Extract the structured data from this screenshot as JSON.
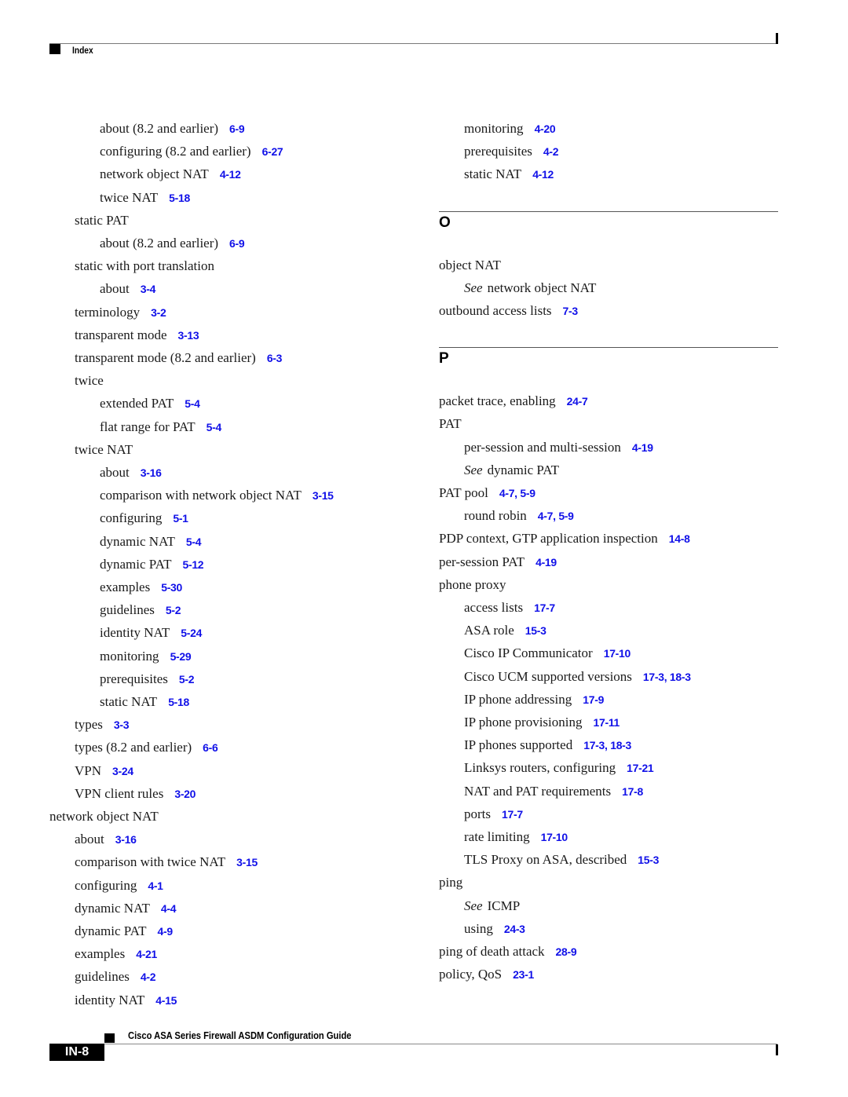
{
  "header": {
    "section_label": "Index"
  },
  "footer": {
    "book_title": "Cisco ASA Series Firewall ASDM Configuration Guide",
    "page_number": "IN-8"
  },
  "colors": {
    "link": "#1010e8",
    "text": "#1a1a1a",
    "rule": "#7a7a7a"
  },
  "left_column": [
    {
      "level": 2,
      "text": "about (8.2 and earlier)",
      "refs": [
        "6-9"
      ]
    },
    {
      "level": 2,
      "text": "configuring (8.2 and earlier)",
      "refs": [
        "6-27"
      ]
    },
    {
      "level": 2,
      "text": "network object NAT",
      "refs": [
        "4-12"
      ]
    },
    {
      "level": 2,
      "text": "twice NAT",
      "refs": [
        "5-18"
      ]
    },
    {
      "level": 1,
      "text": "static PAT",
      "refs": []
    },
    {
      "level": 2,
      "text": "about (8.2 and earlier)",
      "refs": [
        "6-9"
      ]
    },
    {
      "level": 1,
      "text": "static with port translation",
      "refs": []
    },
    {
      "level": 2,
      "text": "about",
      "refs": [
        "3-4"
      ]
    },
    {
      "level": 1,
      "text": "terminology",
      "refs": [
        "3-2"
      ]
    },
    {
      "level": 1,
      "text": "transparent mode",
      "refs": [
        "3-13"
      ]
    },
    {
      "level": 1,
      "text": "transparent mode (8.2 and earlier)",
      "refs": [
        "6-3"
      ]
    },
    {
      "level": 1,
      "text": "twice",
      "refs": []
    },
    {
      "level": 2,
      "text": "extended PAT",
      "refs": [
        "5-4"
      ]
    },
    {
      "level": 2,
      "text": "flat range for PAT",
      "refs": [
        "5-4"
      ]
    },
    {
      "level": 1,
      "text": "twice NAT",
      "refs": []
    },
    {
      "level": 2,
      "text": "about",
      "refs": [
        "3-16"
      ]
    },
    {
      "level": 2,
      "text": "comparison with network object NAT",
      "refs": [
        "3-15"
      ]
    },
    {
      "level": 2,
      "text": "configuring",
      "refs": [
        "5-1"
      ]
    },
    {
      "level": 2,
      "text": "dynamic NAT",
      "refs": [
        "5-4"
      ]
    },
    {
      "level": 2,
      "text": "dynamic PAT",
      "refs": [
        "5-12"
      ]
    },
    {
      "level": 2,
      "text": "examples",
      "refs": [
        "5-30"
      ]
    },
    {
      "level": 2,
      "text": "guidelines",
      "refs": [
        "5-2"
      ]
    },
    {
      "level": 2,
      "text": "identity NAT",
      "refs": [
        "5-24"
      ]
    },
    {
      "level": 2,
      "text": "monitoring",
      "refs": [
        "5-29"
      ]
    },
    {
      "level": 2,
      "text": "prerequisites",
      "refs": [
        "5-2"
      ]
    },
    {
      "level": 2,
      "text": "static NAT",
      "refs": [
        "5-18"
      ]
    },
    {
      "level": 1,
      "text": "types",
      "refs": [
        "3-3"
      ]
    },
    {
      "level": 1,
      "text": "types (8.2 and earlier)",
      "refs": [
        "6-6"
      ]
    },
    {
      "level": 1,
      "text": "VPN",
      "refs": [
        "3-24"
      ]
    },
    {
      "level": 1,
      "text": "VPN client rules",
      "refs": [
        "3-20"
      ]
    },
    {
      "level": 0,
      "text": "network object NAT",
      "refs": []
    },
    {
      "level": 1,
      "text": "about",
      "refs": [
        "3-16"
      ]
    },
    {
      "level": 1,
      "text": "comparison with twice NAT",
      "refs": [
        "3-15"
      ]
    },
    {
      "level": 1,
      "text": "configuring",
      "refs": [
        "4-1"
      ]
    },
    {
      "level": 1,
      "text": "dynamic NAT",
      "refs": [
        "4-4"
      ]
    },
    {
      "level": 1,
      "text": "dynamic PAT",
      "refs": [
        "4-9"
      ]
    },
    {
      "level": 1,
      "text": "examples",
      "refs": [
        "4-21"
      ]
    },
    {
      "level": 1,
      "text": "guidelines",
      "refs": [
        "4-2"
      ]
    },
    {
      "level": 1,
      "text": "identity NAT",
      "refs": [
        "4-15"
      ]
    }
  ],
  "right_column": [
    {
      "type": "entry",
      "level": 1,
      "text": "monitoring",
      "refs": [
        "4-20"
      ]
    },
    {
      "type": "entry",
      "level": 1,
      "text": "prerequisites",
      "refs": [
        "4-2"
      ]
    },
    {
      "type": "entry",
      "level": 1,
      "text": "static NAT",
      "refs": [
        "4-12"
      ]
    },
    {
      "type": "section",
      "letter": "O"
    },
    {
      "type": "entry",
      "level": 0,
      "text": "object NAT",
      "refs": []
    },
    {
      "type": "entry",
      "level": 1,
      "see": "See",
      "text": "network object NAT",
      "refs": []
    },
    {
      "type": "entry",
      "level": 0,
      "text": "outbound access lists",
      "refs": [
        "7-3"
      ]
    },
    {
      "type": "section",
      "letter": "P"
    },
    {
      "type": "entry",
      "level": 0,
      "text": "packet trace, enabling",
      "refs": [
        "24-7"
      ]
    },
    {
      "type": "entry",
      "level": 0,
      "text": "PAT",
      "refs": []
    },
    {
      "type": "entry",
      "level": 1,
      "text": "per-session and multi-session",
      "refs": [
        "4-19"
      ]
    },
    {
      "type": "entry",
      "level": 1,
      "see": "See",
      "text": "dynamic PAT",
      "refs": []
    },
    {
      "type": "entry",
      "level": 0,
      "text": "PAT pool",
      "refs": [
        "4-7, ",
        "5-9"
      ]
    },
    {
      "type": "entry",
      "level": 1,
      "text": "round robin",
      "refs": [
        "4-7, ",
        "5-9"
      ]
    },
    {
      "type": "entry",
      "level": 0,
      "text": "PDP context, GTP application inspection",
      "refs": [
        "14-8"
      ]
    },
    {
      "type": "entry",
      "level": 0,
      "text": "per-session PAT",
      "refs": [
        "4-19"
      ]
    },
    {
      "type": "entry",
      "level": 0,
      "text": "phone proxy",
      "refs": []
    },
    {
      "type": "entry",
      "level": 1,
      "text": "access lists",
      "refs": [
        "17-7"
      ]
    },
    {
      "type": "entry",
      "level": 1,
      "text": "ASA role",
      "refs": [
        "15-3"
      ]
    },
    {
      "type": "entry",
      "level": 1,
      "text": "Cisco IP Communicator",
      "refs": [
        "17-10"
      ]
    },
    {
      "type": "entry",
      "level": 1,
      "text": "Cisco UCM supported versions",
      "refs": [
        "17-3, ",
        "18-3"
      ]
    },
    {
      "type": "entry",
      "level": 1,
      "text": "IP phone addressing",
      "refs": [
        "17-9"
      ]
    },
    {
      "type": "entry",
      "level": 1,
      "text": "IP phone provisioning",
      "refs": [
        "17-11"
      ]
    },
    {
      "type": "entry",
      "level": 1,
      "text": "IP phones supported",
      "refs": [
        "17-3, ",
        "18-3"
      ]
    },
    {
      "type": "entry",
      "level": 1,
      "text": "Linksys routers, configuring",
      "refs": [
        "17-21"
      ]
    },
    {
      "type": "entry",
      "level": 1,
      "text": "NAT and PAT requirements",
      "refs": [
        "17-8"
      ]
    },
    {
      "type": "entry",
      "level": 1,
      "text": "ports",
      "refs": [
        "17-7"
      ]
    },
    {
      "type": "entry",
      "level": 1,
      "text": "rate limiting",
      "refs": [
        "17-10"
      ]
    },
    {
      "type": "entry",
      "level": 1,
      "text": "TLS Proxy on ASA, described",
      "refs": [
        "15-3"
      ]
    },
    {
      "type": "entry",
      "level": 0,
      "text": "ping",
      "refs": []
    },
    {
      "type": "entry",
      "level": 1,
      "see": "See",
      "text": "ICMP",
      "refs": []
    },
    {
      "type": "entry",
      "level": 1,
      "text": "using",
      "refs": [
        "24-3"
      ]
    },
    {
      "type": "entry",
      "level": 0,
      "text": "ping of death attack",
      "refs": [
        "28-9"
      ]
    },
    {
      "type": "entry",
      "level": 0,
      "text": "policy, QoS",
      "refs": [
        "23-1"
      ]
    }
  ]
}
